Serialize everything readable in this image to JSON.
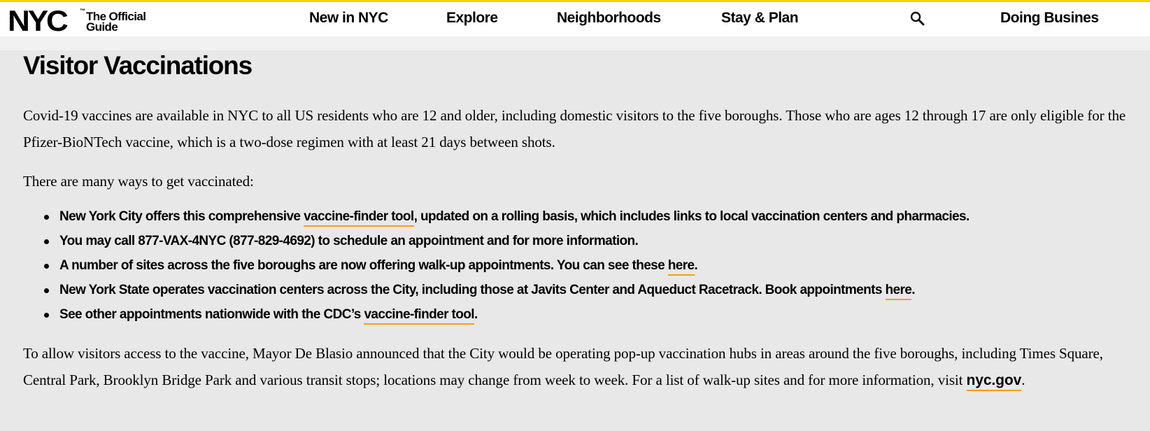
{
  "header": {
    "logo_mark": "NYC",
    "logo_tm": "™",
    "logo_line1": "The Official",
    "logo_line2": "Guide",
    "nav": [
      {
        "label": "New in NYC"
      },
      {
        "label": "Explore"
      },
      {
        "label": "Neighborhoods"
      },
      {
        "label": "Stay & Plan"
      },
      {
        "label": "Doing Busines"
      }
    ],
    "search_icon": "search-icon"
  },
  "main": {
    "title": "Visitor Vaccinations",
    "intro": "Covid-19 vaccines are available in NYC to all US residents who are 12 and older, including domestic visitors to the five boroughs. Those who are ages 12 through 17 are only eligible for the Pfizer-BioNTech vaccine, which is a two-dose regimen with at least 21 days between shots.",
    "ways_heading": "There are many ways to get vaccinated:",
    "bullets": [
      {
        "before": "New York City offers this comprehensive ",
        "link": "vaccine-finder tool",
        "after": ", updated on a rolling basis, which includes links to local vaccination centers and pharmacies."
      },
      {
        "before": "You may call 877-VAX-4NYC (877-829-4692) to schedule an appointment and for more information.",
        "link": "",
        "after": ""
      },
      {
        "before": "A number of sites across the five boroughs are now offering walk-up appointments. You can see these ",
        "link": "here",
        "after": "."
      },
      {
        "before": "New York State operates vaccination centers across the City, including those at Javits Center and Aqueduct Racetrack. Book appointments ",
        "link": "here",
        "after": "."
      },
      {
        "before": "See other appointments nationwide with the CDC’s ",
        "link": "vaccine-finder tool",
        "after": "."
      }
    ],
    "closing_before": "To allow visitors access to the vaccine, Mayor De Blasio announced that the City would be operating pop-up vaccination hubs in areas around the five boroughs, including Times Square, Central Park, Brooklyn Bridge Park and various transit stops; locations may change from week to week. For a list of walk-up sites and for more information, visit ",
    "closing_link": "nyc.gov",
    "closing_after": "."
  },
  "colors": {
    "accent_yellow": "#f5d300",
    "link_underline": "#f0a020",
    "page_bg": "#e8e8e8"
  }
}
